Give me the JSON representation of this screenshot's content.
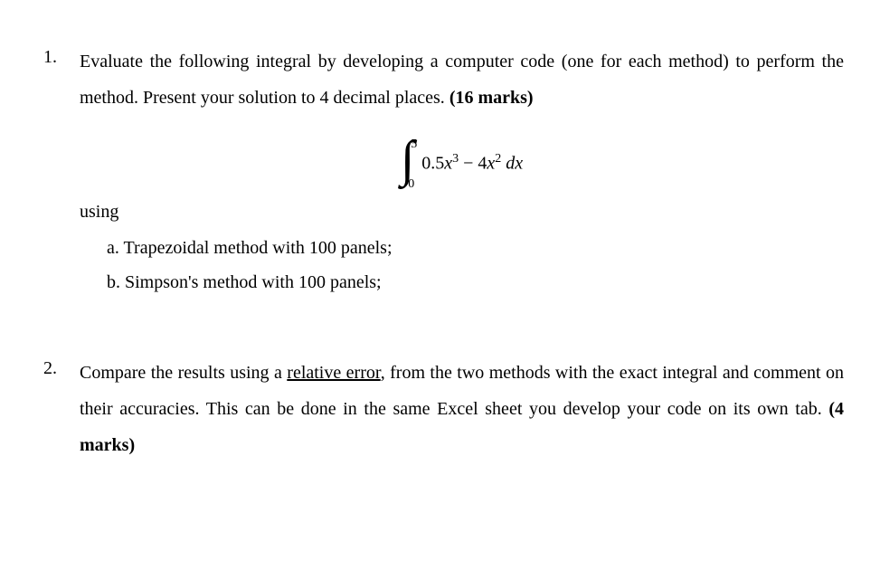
{
  "q1": {
    "number": "1.",
    "text_before_bold": "Evaluate the following integral by developing a computer code (one for each method) to perform the method. Present your solution to 4 decimal places. ",
    "marks": "(16 marks)",
    "integral": {
      "upper": "5",
      "lower": "0",
      "expr_05": "0.5",
      "expr_x": "x",
      "expr_cube": "3",
      "expr_minus": " − ",
      "expr_4": "4",
      "expr_x2": "x",
      "expr_square": "2",
      "expr_dx": " dx"
    },
    "using": "using",
    "sub_a": "a. Trapezoidal method with 100 panels;",
    "sub_b": "b. Simpson's method with 100 panels;"
  },
  "q2": {
    "number": "2.",
    "text_part1": "Compare the results using a ",
    "underlined": "relative error",
    "text_part2": ", from the two methods with the exact integral and comment on their accuracies. This can be done in the same Excel sheet you develop your code on its own tab.  ",
    "marks": "(4 marks)"
  }
}
